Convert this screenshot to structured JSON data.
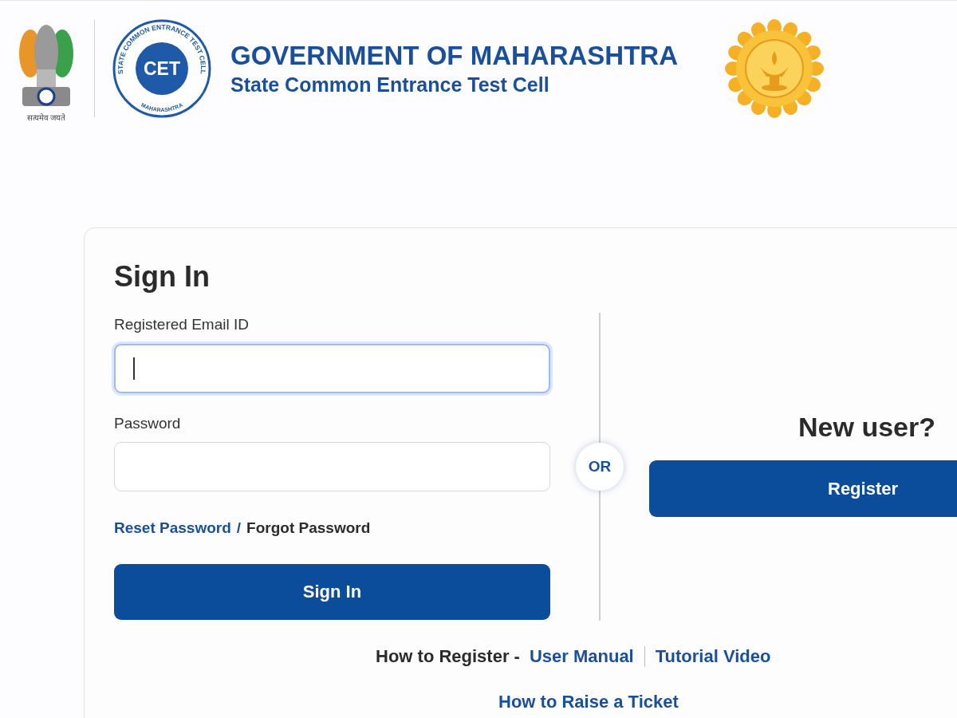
{
  "header": {
    "emblem_motto": "सत्यमेव जयते",
    "cet_logo": {
      "ring_top": "STATE COMMON ENTRANCE TEST CELL",
      "center": "CET",
      "ring_bottom": "MAHARASHTRA"
    },
    "title": "GOVERNMENT OF MAHARASHTRA",
    "subtitle": "State Common Entrance Test Cell"
  },
  "sign_in": {
    "heading": "Sign In",
    "fields": [
      {
        "label": "Registered Email ID",
        "focused": true
      },
      {
        "label": "Password",
        "focused": false
      }
    ],
    "reset_link": "Reset Password",
    "separator": "/",
    "forgot_text": "Forgot Password",
    "button": "Sign In"
  },
  "divider_label": "OR",
  "new_user": {
    "heading": "New user?",
    "button": "Register"
  },
  "help": {
    "register_label": "How to Register -",
    "links": [
      "User Manual",
      "Tutorial Video"
    ],
    "ticket_link": "How to Raise a Ticket"
  }
}
